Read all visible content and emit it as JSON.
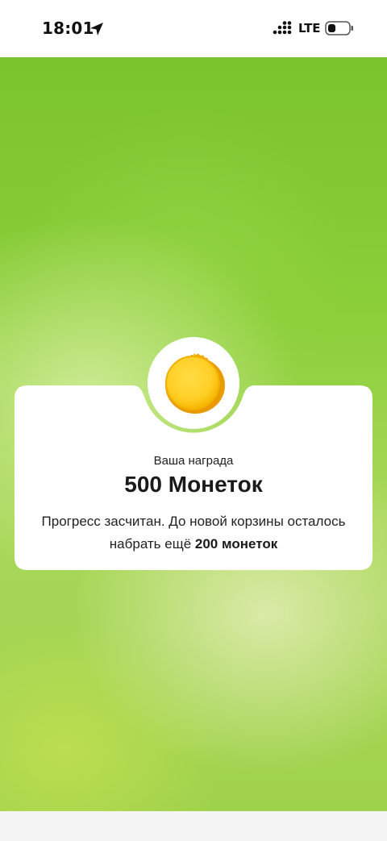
{
  "status_bar": {
    "time": "18:01",
    "network": "LTE",
    "icons": [
      "location-arrow-icon",
      "signal-bars-icon",
      "battery-icon"
    ]
  },
  "colors": {
    "background_green": "#8ccf3a",
    "card": "#ffffff",
    "coin_gold": "#f5b800",
    "coin_light": "#ffd23a"
  },
  "reward": {
    "icon": "coin-icon",
    "caption": "Ваша награда",
    "amount": "500 Монеток",
    "description_text": "Прогресс засчитан. До новой корзины осталось набрать ещё ",
    "description_highlight": "200 монеток"
  }
}
